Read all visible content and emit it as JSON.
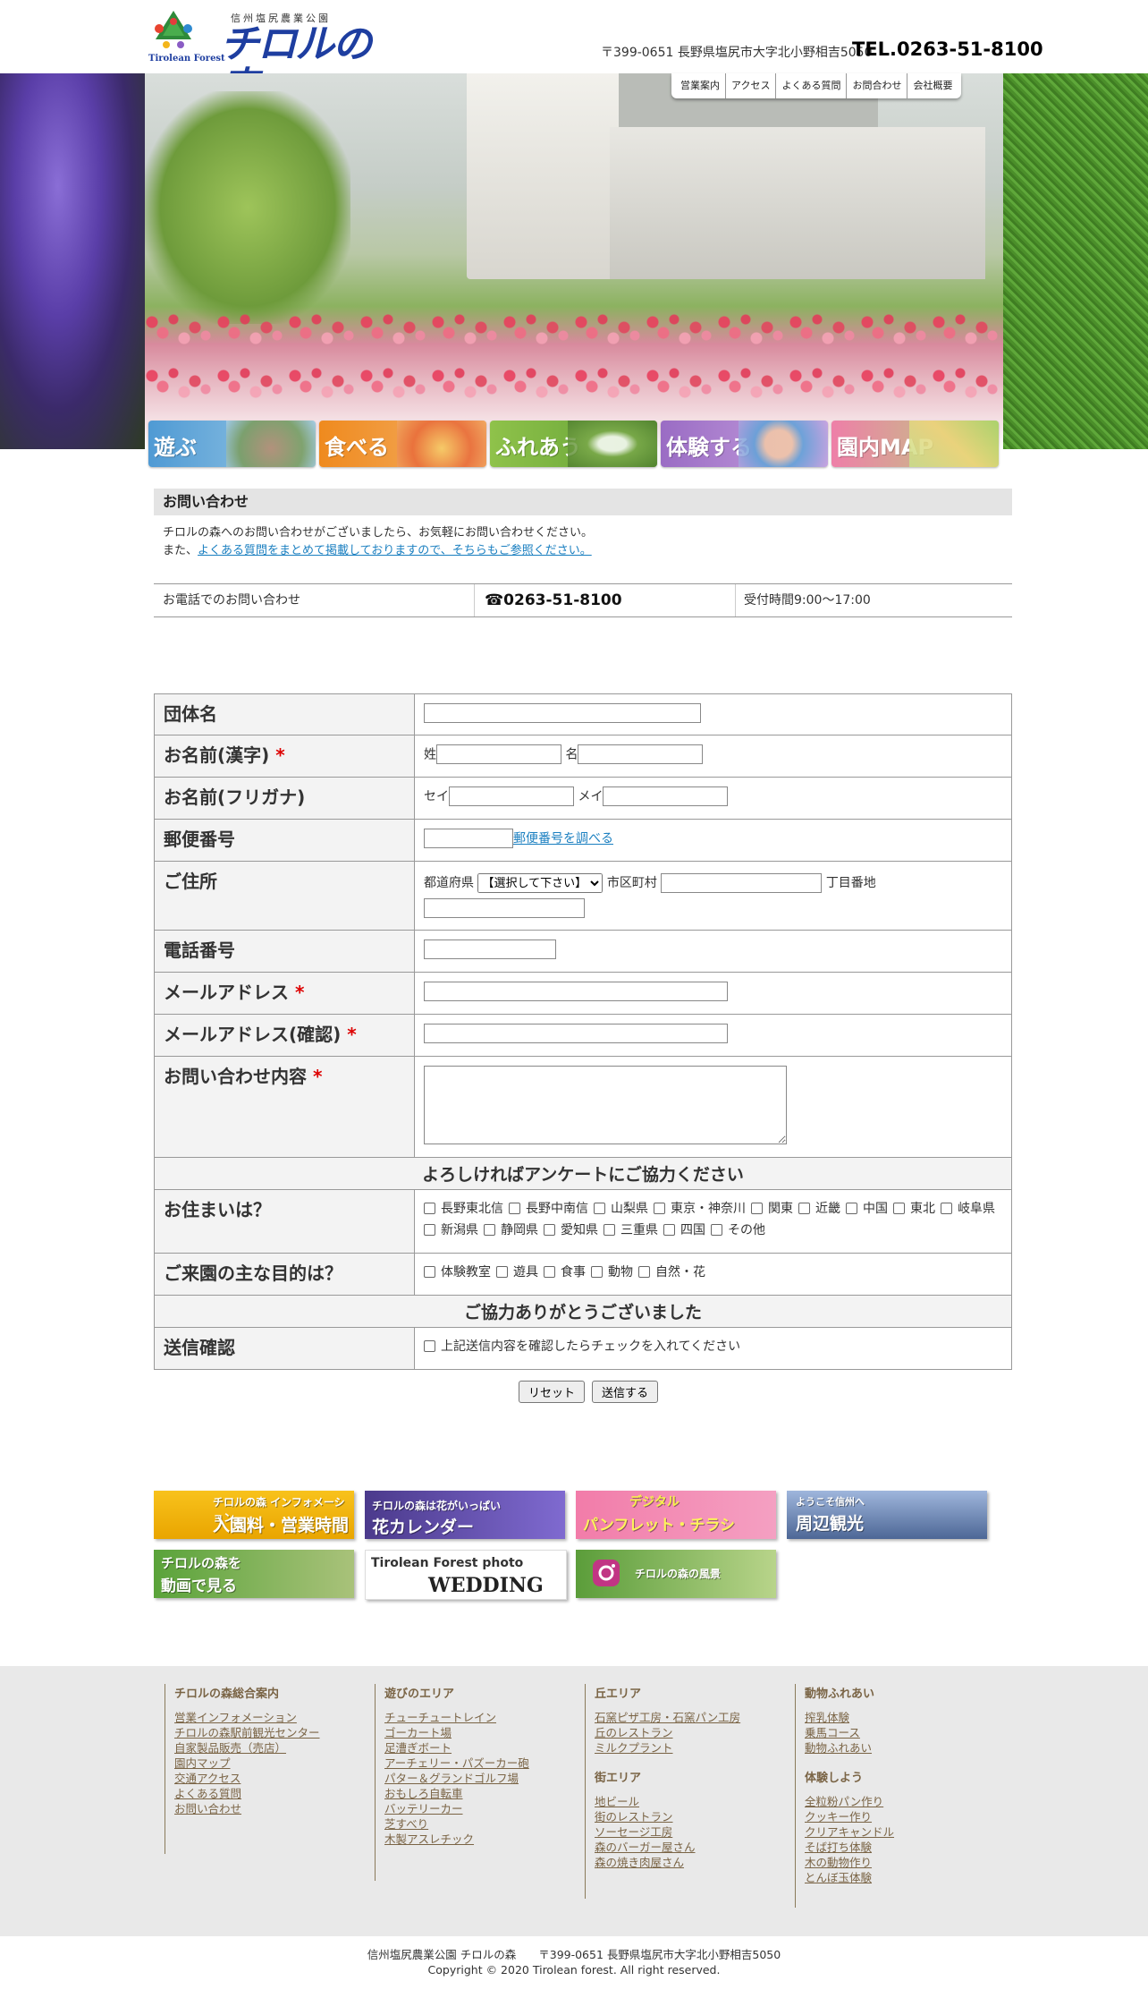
{
  "header": {
    "logo_sub": "信州塩尻農業公園",
    "logo_main": "チロルの森",
    "logo_en": "Tirolean Forest",
    "address": "〒399-0651 長野県塩尻市大字北小野相吉5050",
    "tel": "TEL.0263-51-8100"
  },
  "topnav": [
    "営業案内",
    "アクセス",
    "よくある質問",
    "お問合わせ",
    "会社概要"
  ],
  "categories": [
    {
      "label": "遊ぶ",
      "color": "#5aa3d8"
    },
    {
      "label": "食べる",
      "color": "#ef8a1e"
    },
    {
      "label": "ふれあう",
      "color": "#8fc24a"
    },
    {
      "label": "体験する",
      "color": "#9a6cc4"
    },
    {
      "label": "園内MAP",
      "color": "#ee7fa8"
    }
  ],
  "page": {
    "title": "お問い合わせ",
    "intro_line1": "チロルの森へのお問い合わせがございましたら、お気軽にお問い合わせください。",
    "intro_line2_prefix": "また、",
    "intro_link": "よくある質問をまとめて掲載しておりますので、そちらもご参照ください。",
    "phone_label": "お電話でのお問い合わせ",
    "phone_number": "☎0263-51-8100",
    "phone_hours": "受付時間9:00〜17:00"
  },
  "form": {
    "org_label": "団体名",
    "name_kanji_label": "お名前(漢字)",
    "sei": "姓",
    "mei": "名",
    "name_kana_label": "お名前(フリガナ)",
    "sei_kana": "セイ",
    "mei_kana": "メイ",
    "zip_label": "郵便番号",
    "zip_link": "郵便番号を調べる",
    "address_label": "ご住所",
    "pref_label": "都道府県",
    "pref_selected": "【選択して下さい】",
    "city_label": "市区町村",
    "street_label": "丁目番地",
    "phone_label": "電話番号",
    "email_label": "メールアドレス",
    "email_confirm_label": "メールアドレス(確認)",
    "inquiry_label": "お問い合わせ内容",
    "required_mark": "*",
    "survey_head": "よろしければアンケートにご協力ください",
    "residence_label": "お住まいは？",
    "residence_options": [
      "長野東北信",
      "長野中南信",
      "山梨県",
      "東京・神奈川",
      "関東",
      "近畿",
      "中国",
      "東北",
      "岐阜県",
      "新潟県",
      "静岡県",
      "愛知県",
      "三重県",
      "四国",
      "その他"
    ],
    "purpose_label": "ご来園の主な目的は？",
    "purpose_options": [
      "体験教室",
      "遊具",
      "食事",
      "動物",
      "自然・花"
    ],
    "thanks_head": "ご協力ありがとうございました",
    "confirm_label": "送信確認",
    "confirm_text": "上記送信内容を確認したらチェックを入れてください",
    "reset": "リセット",
    "submit": "送信する"
  },
  "banners": [
    {
      "line1": "チロルの森 インフォメーション",
      "line2": "入園料・営業時間",
      "color": "#f2b300"
    },
    {
      "line1": "チロルの森は花がいっぱい",
      "line2": "花カレンダー",
      "color": "#6a52b8"
    },
    {
      "line1": "デジタル",
      "line2": "パンフレット・チラシ",
      "color": "#f06fa0"
    },
    {
      "line1": "ようこそ信州へ",
      "line2": "周辺観光",
      "color": "#6d8fc7"
    },
    {
      "line1": "チロルの森を",
      "line2": "動画で見る",
      "color": "#5d9a3a"
    },
    {
      "line1": "Tirolean Forest photo",
      "line2": "WEDDING",
      "color": "#ffffff"
    },
    {
      "line1": "",
      "line2": "チロルの森の風景",
      "color": "#6aa84f"
    }
  ],
  "footer": {
    "cols": [
      {
        "title": "チロルの森総合案内",
        "links": [
          "営業インフォメーション",
          "チロルの森駅前観光センター",
          "自家製品販売（売店）",
          "園内マップ",
          "交通アクセス",
          "よくある質問",
          "お問い合わせ"
        ]
      },
      {
        "title": "遊びのエリア",
        "links": [
          "チューチュートレイン",
          "ゴーカート場",
          "足漕ぎボート",
          "アーチェリー・パズーカー砲",
          "パター＆グランドゴルフ場",
          "おもしろ自転車",
          "バッテリーカー",
          "芝すべり",
          "木製アスレチック"
        ]
      },
      {
        "title": "丘エリア",
        "links": [
          "石窯ピザ工房・石窯パン工房",
          "丘のレストラン",
          "ミルクプラント"
        ],
        "title2": "街エリア",
        "links2": [
          "地ビール",
          "街のレストラン",
          "ソーセージ工房",
          "森のバーガー屋さん",
          "森の焼き肉屋さん"
        ]
      },
      {
        "title": "動物ふれあい",
        "links": [
          "搾乳体験",
          "乗馬コース",
          "動物ふれあい"
        ],
        "title2": "体験しよう",
        "links2": [
          "全粒粉パン作り",
          "クッキー作り",
          "クリアキャンドル",
          "そば打ち体験",
          "木の動物作り",
          "とんぼ玉体験"
        ]
      }
    ],
    "address_line": "信州塩尻農業公園 チロルの森　　〒399-0651 長野県塩尻市大字北小野相吉5050",
    "copyright": "Copyright © 2020 Tirolean forest. All right reserved."
  }
}
